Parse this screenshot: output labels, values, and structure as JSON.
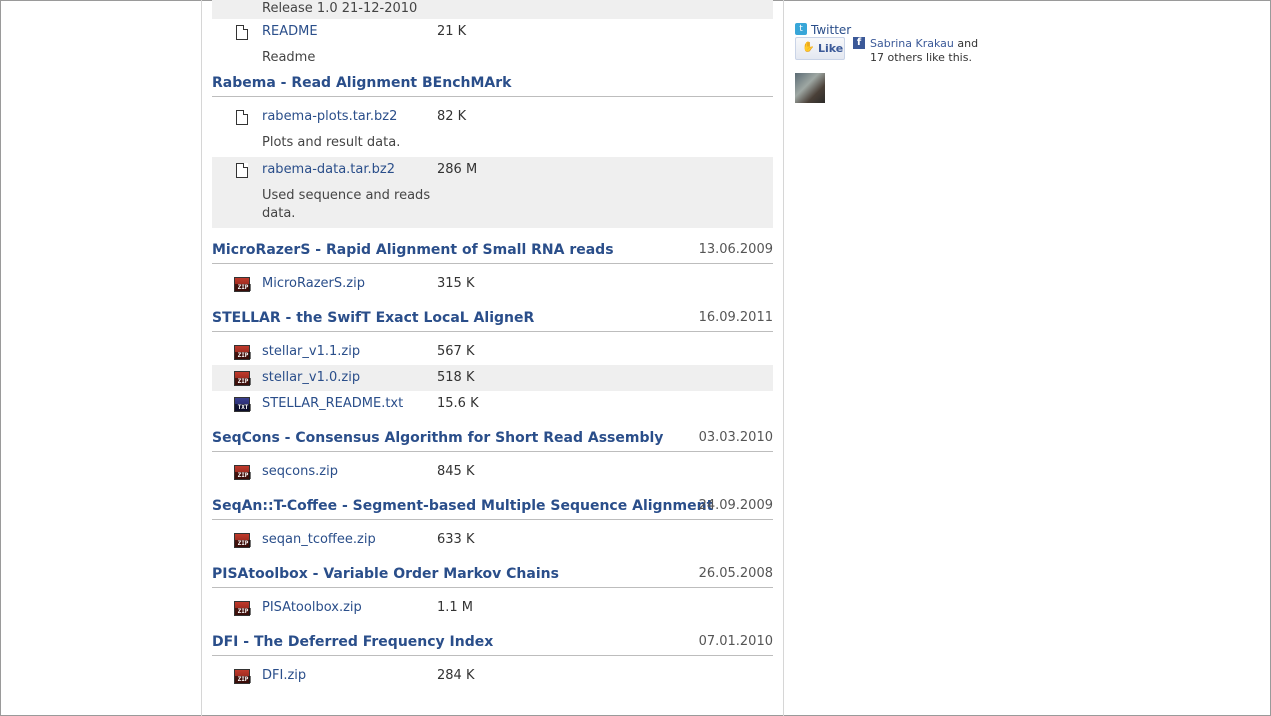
{
  "top": {
    "release_text": "Release 1.0 21-12-2010",
    "files": [
      {
        "name": "README",
        "size": "21 K",
        "desc": "Readme"
      }
    ]
  },
  "sections": [
    {
      "title": "Rabema - Read Alignment BEnchMArk",
      "date": "",
      "files": [
        {
          "name": "rabema-plots.tar.bz2",
          "size": "82 K",
          "desc": "Plots and result data.",
          "icon": "document-icon"
        },
        {
          "name": "rabema-data.tar.bz2",
          "size": "286 M",
          "desc": "Used sequence and reads data.",
          "icon": "document-icon"
        }
      ]
    },
    {
      "title": "MicroRazerS - Rapid Alignment of Small RNA reads",
      "date": "13.06.2009",
      "files": [
        {
          "name": "MicroRazerS.zip",
          "size": "315 K",
          "icon": "zip-file-icon"
        }
      ]
    },
    {
      "title": "STELLAR - the SwifT Exact LocaL AligneR",
      "date": "16.09.2011",
      "files": [
        {
          "name": "stellar_v1.1.zip",
          "size": "567 K",
          "icon": "zip-file-icon"
        },
        {
          "name": "stellar_v1.0.zip",
          "size": "518 K",
          "icon": "zip-file-icon"
        },
        {
          "name": "STELLAR_README.txt",
          "size": "15.6 K",
          "icon": "txt-file-icon"
        }
      ]
    },
    {
      "title": "SeqCons - Consensus Algorithm for Short Read Assembly",
      "date": "03.03.2010",
      "files": [
        {
          "name": "seqcons.zip",
          "size": "845 K",
          "icon": "zip-file-icon"
        }
      ]
    },
    {
      "title": "SeqAn::T-Coffee - Segment-based Multiple Sequence Alignment",
      "date": "24.09.2009",
      "files": [
        {
          "name": "seqan_tcoffee.zip",
          "size": "633 K",
          "icon": "zip-file-icon"
        }
      ]
    },
    {
      "title": "PISAtoolbox - Variable Order Markov Chains",
      "date": "26.05.2008",
      "files": [
        {
          "name": "PISAtoolbox.zip",
          "size": "1.1 M",
          "icon": "zip-file-icon"
        }
      ]
    },
    {
      "title": "DFI - The Deferred Frequency Index",
      "date": "07.01.2010",
      "files": [
        {
          "name": "DFI.zip",
          "size": "284 K",
          "icon": "zip-file-icon"
        }
      ]
    }
  ],
  "icons": {
    "zip_label": "ZIP",
    "txt_label": "TXT"
  },
  "sidebar": {
    "twitter_label": "Twitter",
    "like_label": "Like",
    "liker_name": "Sabrina Krakau",
    "liker_and": "and",
    "liker_rest": "17 others like this."
  },
  "colors": {
    "link": "#2a4e8a",
    "zip": "#c0392b",
    "txt": "#3a3f8f",
    "facebook": "#3b5998"
  }
}
